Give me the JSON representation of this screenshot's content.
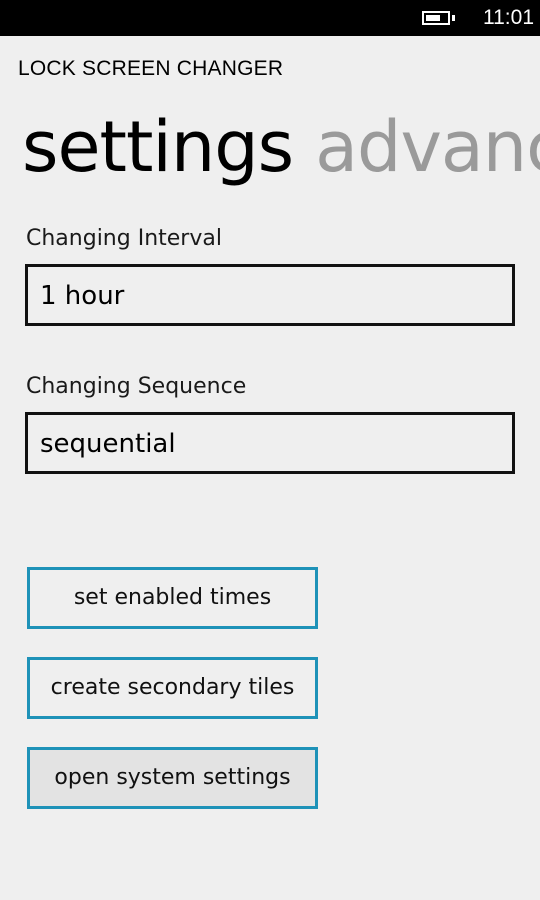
{
  "status_bar": {
    "time": "11:01",
    "battery_level": 0.7
  },
  "app": {
    "title": "LOCK SCREEN CHANGER"
  },
  "pivot": {
    "active": "settings",
    "next": "advanc"
  },
  "changing_interval": {
    "label": "Changing Interval",
    "value": "1 hour"
  },
  "changing_sequence": {
    "label": "Changing Sequence",
    "value": "sequential"
  },
  "buttons": {
    "set_enabled_times": "set enabled times",
    "create_secondary_tiles": "create secondary tiles",
    "open_system_settings": "open system settings"
  },
  "colors": {
    "accent": "#1e92b8",
    "background": "#efefef"
  }
}
